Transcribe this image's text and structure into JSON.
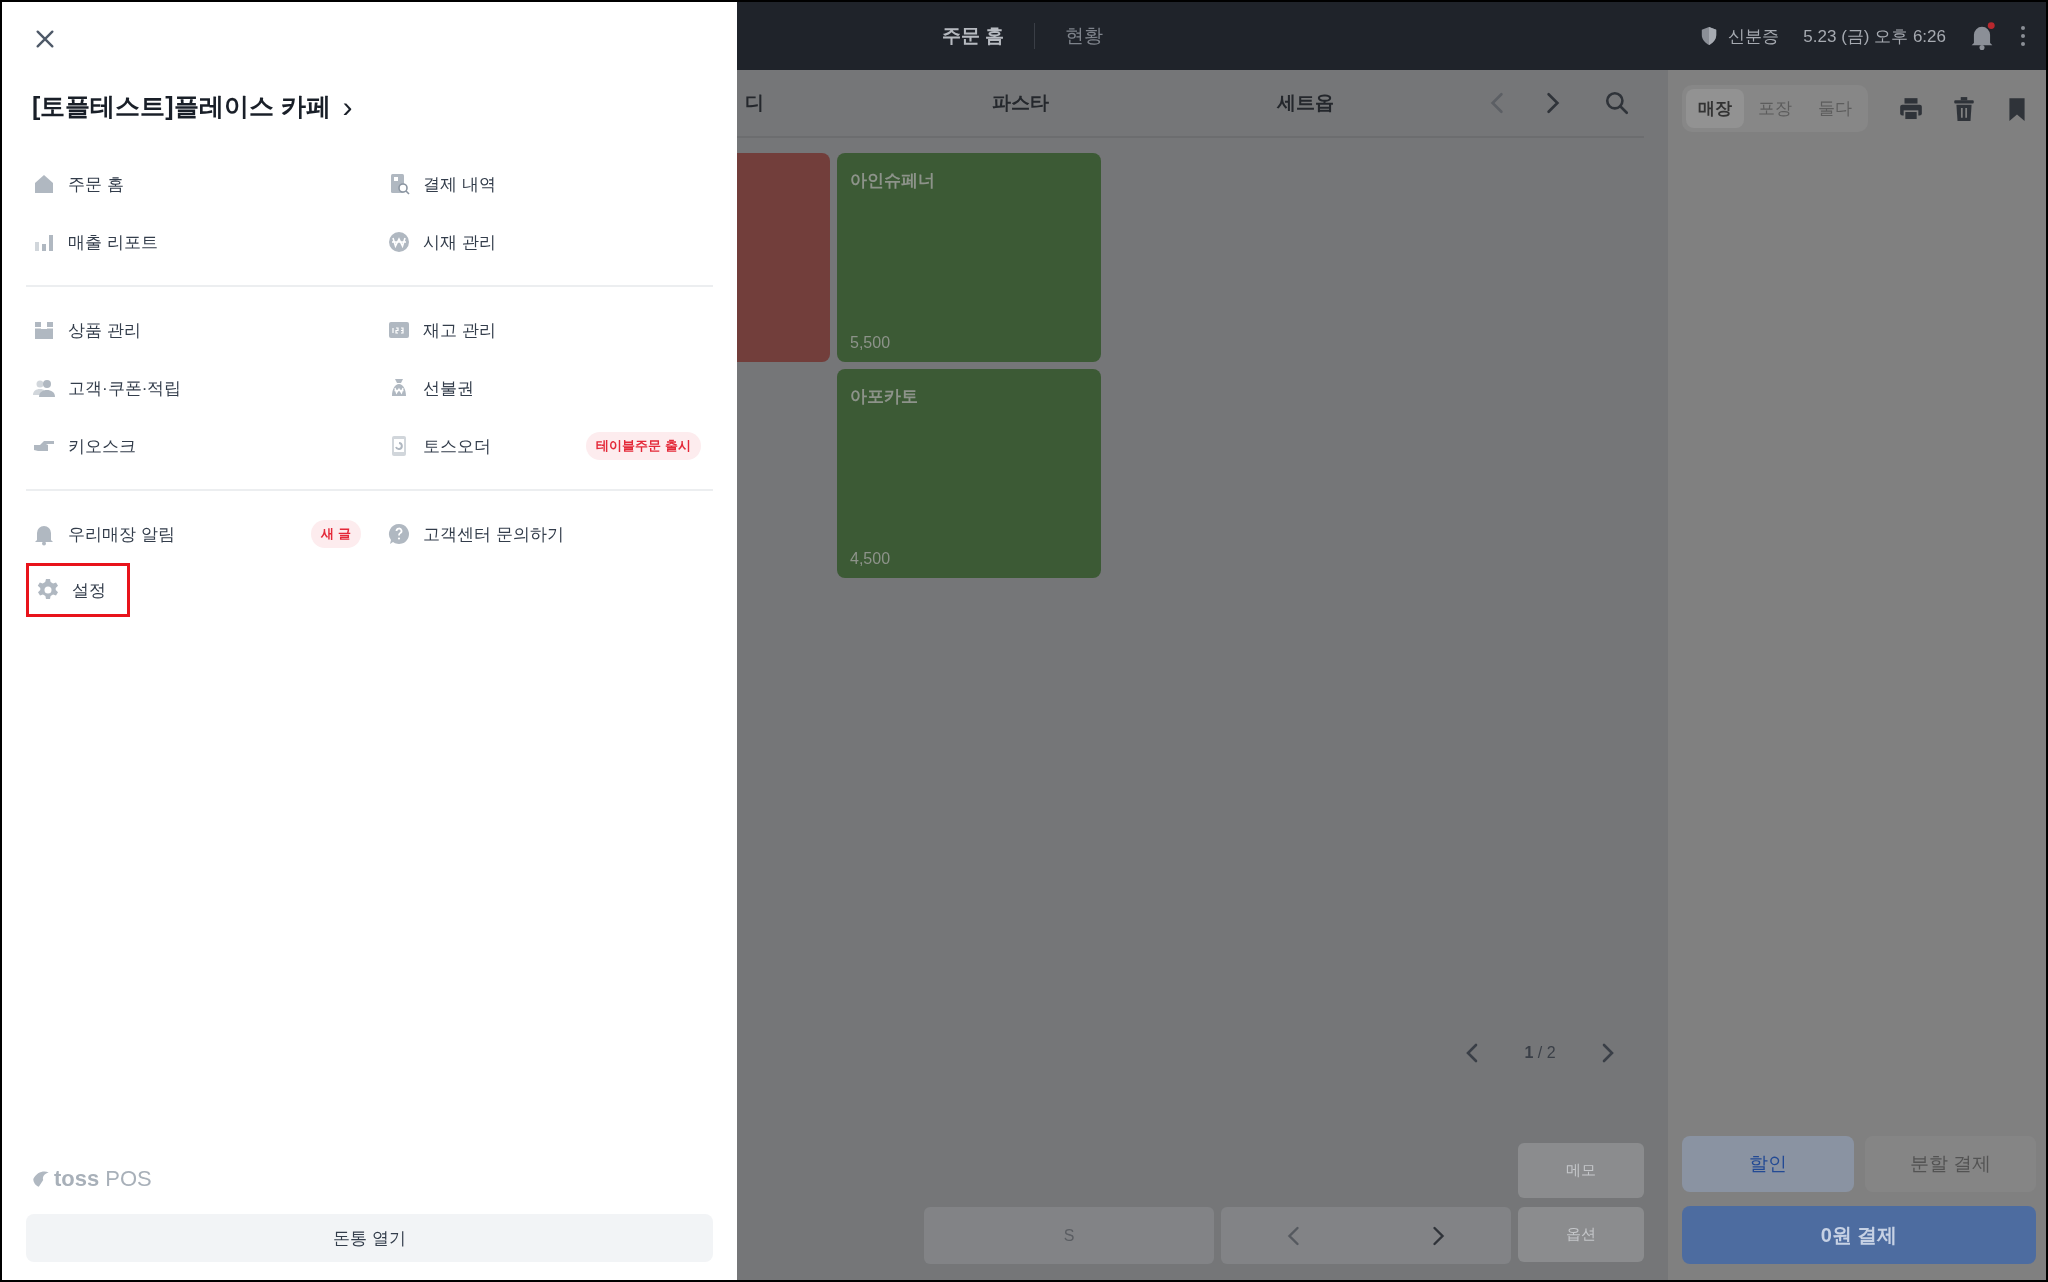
{
  "drawer": {
    "store_name": "[토플테스트]플레이스 카페",
    "store_chevron": "›",
    "sections": [
      {
        "items": [
          {
            "label": "주문 홈",
            "highlighted": false
          },
          {
            "label": "결제 내역",
            "highlighted": false
          },
          {
            "label": "매출 리포트",
            "highlighted": false
          },
          {
            "label": "시재 관리",
            "highlighted": false
          }
        ]
      },
      {
        "items": [
          {
            "label": "상품 관리",
            "highlighted": false
          },
          {
            "label": "재고 관리",
            "highlighted": false
          },
          {
            "label": "고객·쿠폰·적립",
            "highlighted": false
          },
          {
            "label": "선불권",
            "highlighted": false
          },
          {
            "label": "키오스크",
            "highlighted": false
          },
          {
            "label": "토스오더",
            "badge": "테이블주문 출시",
            "highlighted": false
          }
        ]
      },
      {
        "items": [
          {
            "label": "우리매장 알림",
            "badge": "새 글",
            "highlighted": false
          },
          {
            "label": "고객센터 문의하기",
            "highlighted": false
          },
          {
            "label": "설정",
            "highlighted": true
          }
        ]
      }
    ],
    "logo": {
      "brand": "toss",
      "product": "POS"
    },
    "cash_drawer_button": "돈통 열기"
  },
  "top_bar": {
    "tabs": [
      {
        "label": "주문 홈",
        "selected": true
      },
      {
        "label": "현황",
        "selected": false
      }
    ],
    "id_card": "신분증",
    "datetime": "5.23 (금) 오후 6:26",
    "notification_unread": true
  },
  "categories": [
    {
      "label": "디"
    },
    {
      "label": "파스타"
    },
    {
      "label": "세트옵"
    }
  ],
  "category_prev_disabled": true,
  "products": [
    {
      "kind": "partial",
      "color": "#723e3b"
    },
    {
      "kind": "full",
      "name": "아인슈페너",
      "price": "5,500",
      "color": "#3c5a35"
    },
    {
      "kind": "full",
      "name": "아포카토",
      "price": "4,500",
      "color": "#3c5a35"
    }
  ],
  "pagination": {
    "text": "**1** / 2"
  },
  "bottom_buttons": {
    "memo": "메모",
    "size": "S",
    "option": "옵션"
  },
  "order_panel": {
    "order_types": [
      {
        "label": "매장",
        "selected": true
      },
      {
        "label": "포장",
        "selected": false
      },
      {
        "label": "둘다",
        "selected": false
      }
    ],
    "discount": "할인",
    "split_payment": "분할 결제",
    "pay": "0원 결제"
  }
}
